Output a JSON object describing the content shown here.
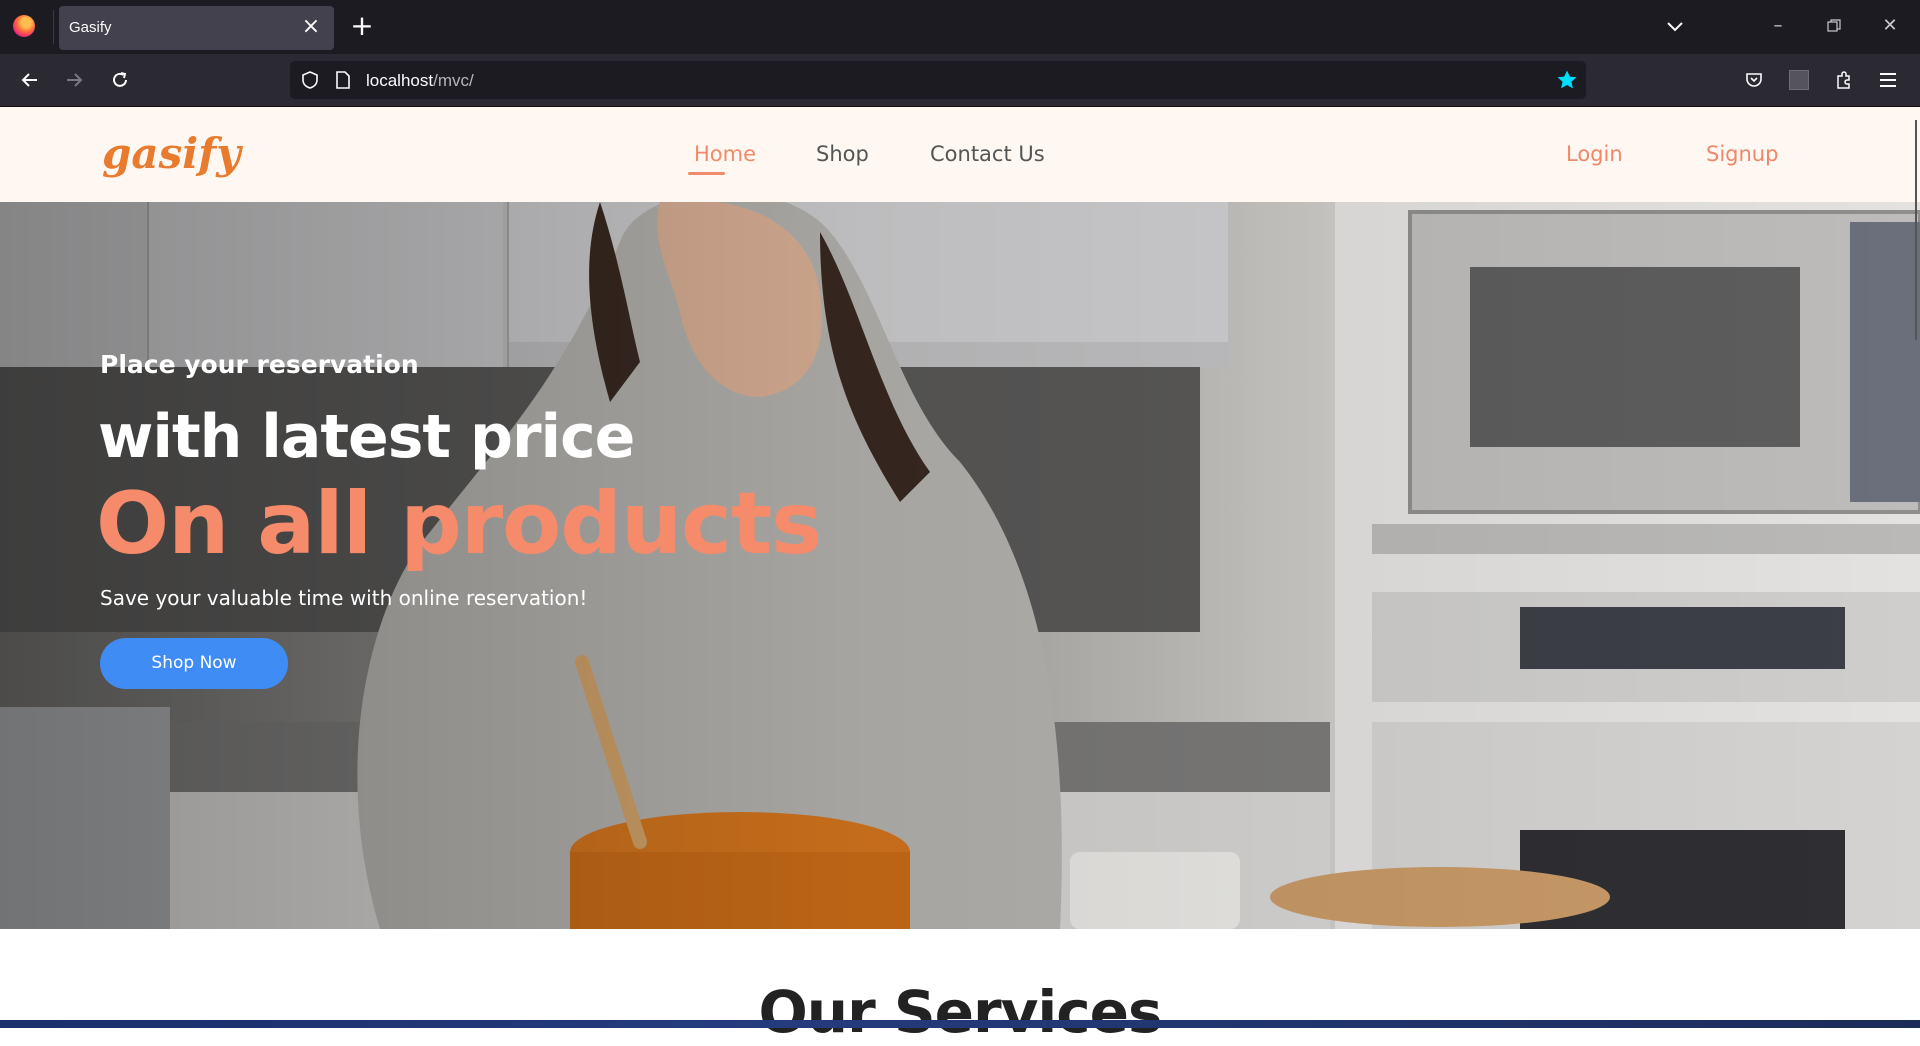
{
  "browser": {
    "tab_title": "Gasify",
    "url_host": "localhost",
    "url_path": "/mvc/",
    "colors": {
      "tabstrip": "#1c1b22",
      "toolbar": "#2b2a33",
      "bookmark_star": "#00ddff"
    }
  },
  "site": {
    "brand": "gasify",
    "nav": {
      "home": "Home",
      "shop": "Shop",
      "contact": "Contact Us",
      "login": "Login",
      "signup": "Signup"
    },
    "hero": {
      "line1": "Place your reservation",
      "line2": "with latest price",
      "line3": "On all products",
      "subtitle": "Save your valuable time with online reservation!",
      "cta": "Shop Now"
    },
    "services_title": "Our Services",
    "colors": {
      "brand": "#e87b2e",
      "accent": "#f58b6b",
      "cta": "#3f8cf5",
      "header_bg": "#fff8f2"
    }
  }
}
